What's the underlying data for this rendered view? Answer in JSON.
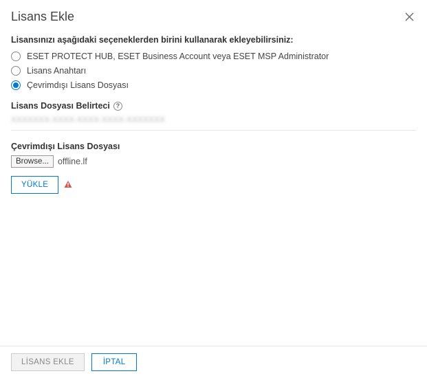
{
  "dialog": {
    "title": "Lisans Ekle",
    "instruction": "Lisansınızı aşağıdaki seçeneklerden birini kullanarak ekleyebilirsiniz:"
  },
  "radios": {
    "opt1": "ESET PROTECT HUB, ESET Business Account veya ESET MSP Administrator",
    "opt2": "Lisans Anahtarı",
    "opt3": "Çevrimdışı Lisans Dosyası"
  },
  "token": {
    "heading": "Lisans Dosyası Belirteci",
    "value": "XXXXXXX-XXXX-XXXX-XXXX-XXXXXXX"
  },
  "offline": {
    "heading": "Çevrimdışı Lisans Dosyası",
    "browse": "Browse...",
    "filename": "offline.lf",
    "upload": "YÜKLE"
  },
  "footer": {
    "add": "LİSANS EKLE",
    "cancel": "İPTAL"
  }
}
